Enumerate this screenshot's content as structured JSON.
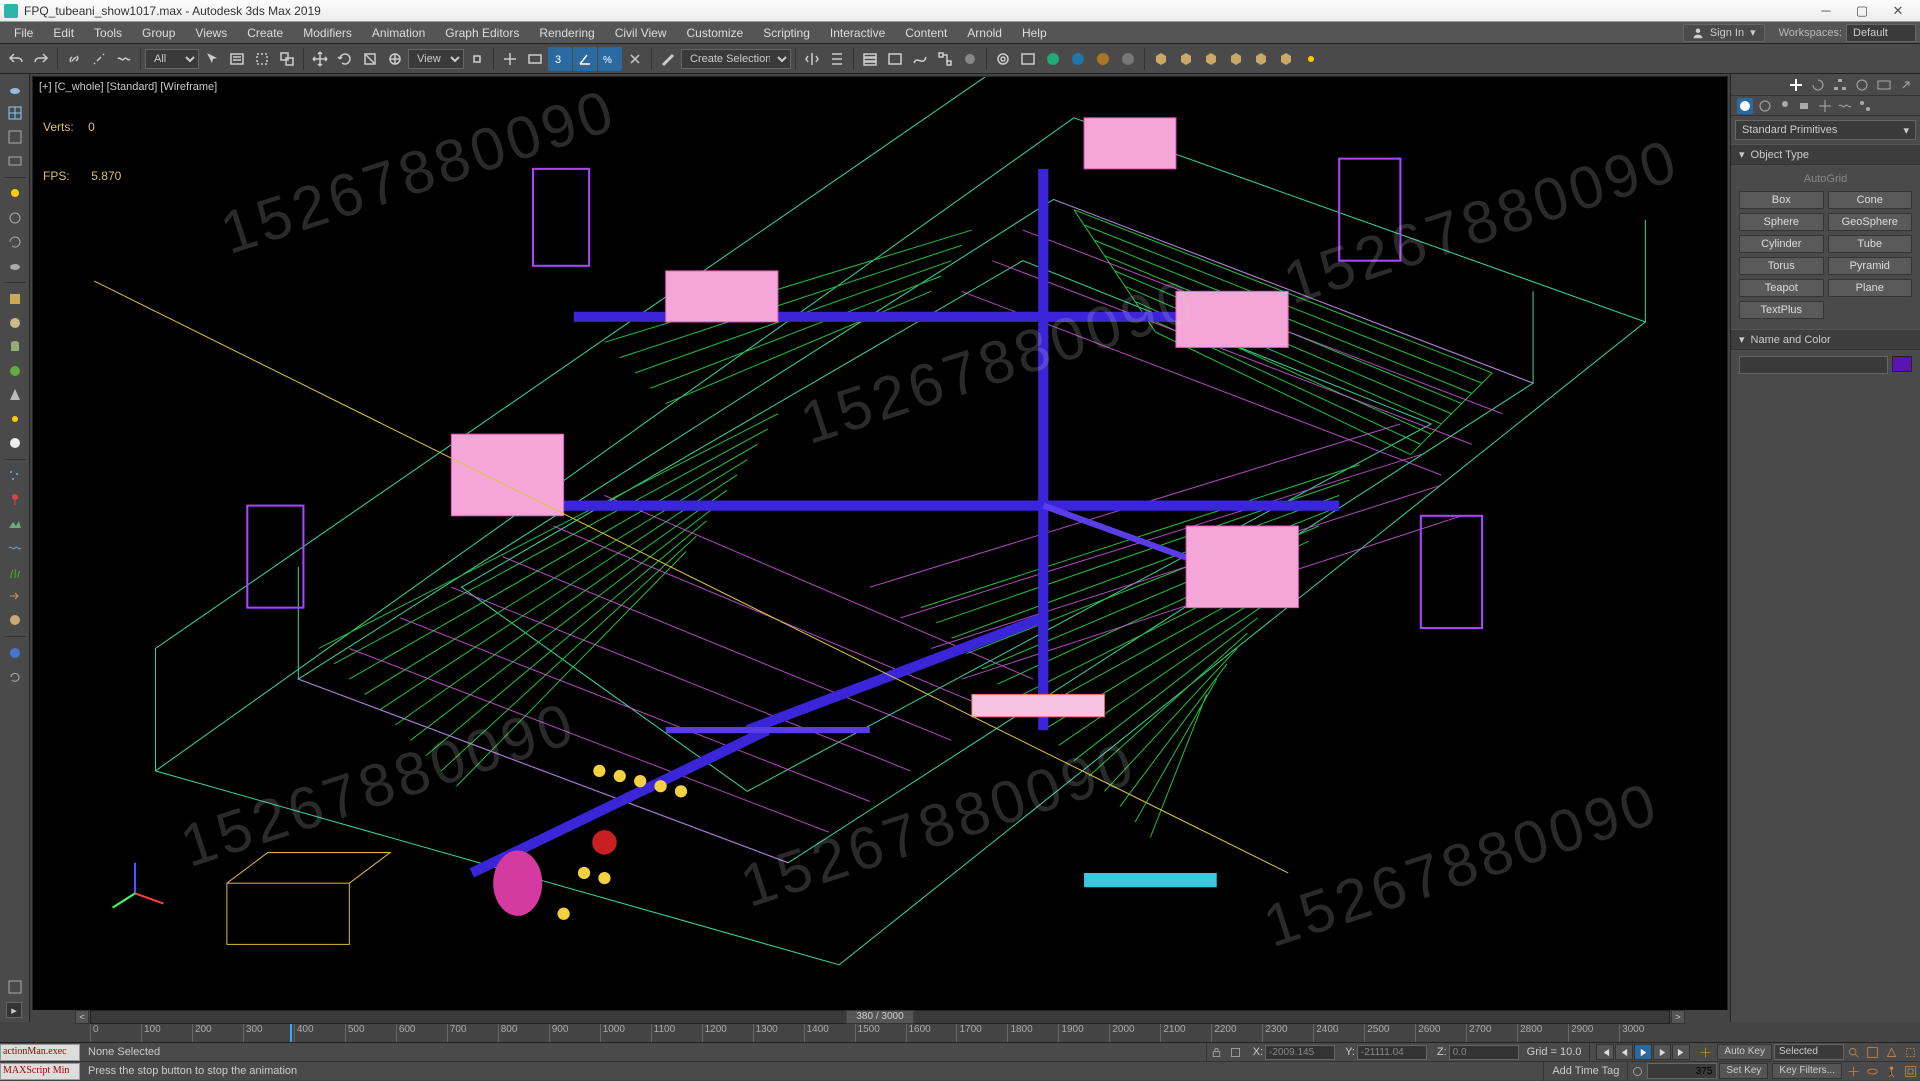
{
  "title": "FPQ_tubeani_show1017.max - Autodesk 3ds Max 2019",
  "menus": [
    "File",
    "Edit",
    "Tools",
    "Group",
    "Views",
    "Create",
    "Modifiers",
    "Animation",
    "Graph Editors",
    "Rendering",
    "Civil View",
    "Customize",
    "Scripting",
    "Interactive",
    "Content",
    "Arnold",
    "Help"
  ],
  "signin": "Sign In",
  "workspace_label": "Workspaces:",
  "workspace_value": "Default",
  "filter_all": "All",
  "view_dd": "View",
  "create_sel_set": "Create Selection Set",
  "viewport_label": "[+] [C_whole] [Standard] [Wireframe]",
  "stats": {
    "verts_label": "Verts:",
    "verts": "0",
    "fps_label": "FPS:",
    "fps": "5.870"
  },
  "watermark": "15267880090",
  "cmd": {
    "category": "Standard Primitives",
    "roll1": "Object Type",
    "autogrid": "AutoGrid",
    "prims": [
      [
        "Box",
        "Cone"
      ],
      [
        "Sphere",
        "GeoSphere"
      ],
      [
        "Cylinder",
        "Tube"
      ],
      [
        "Torus",
        "Pyramid"
      ],
      [
        "Teapot",
        "Plane"
      ],
      [
        "TextPlus",
        ""
      ]
    ],
    "roll2": "Name and Color"
  },
  "timeline": {
    "frame_display": "380 / 3000",
    "ticks": [
      0,
      100,
      200,
      300,
      400,
      500,
      600,
      700,
      800,
      900,
      1000,
      1100,
      1200,
      1300,
      1400,
      1500,
      1600,
      1700,
      1800,
      1900,
      2000,
      2100,
      2200,
      2300,
      2400,
      2500,
      2600,
      2700,
      2800,
      2900,
      3000
    ],
    "head_pct": 12.67
  },
  "status": {
    "script1": "actionMan.exec",
    "script2": "MAXScript Min",
    "sel": "None Selected",
    "prompt": "Press the stop button to stop the animation",
    "X_lab": "X:",
    "X": "-2009.145",
    "Y_lab": "Y:",
    "Y": "-21111.04",
    "Z_lab": "Z:",
    "Z": "0.0",
    "grid": "Grid = 10.0",
    "addtag": "Add Time Tag",
    "frame": "375",
    "autokey": "Auto Key",
    "setkey": "Set Key",
    "selected": "Selected",
    "keyfilters": "Key Filters..."
  }
}
